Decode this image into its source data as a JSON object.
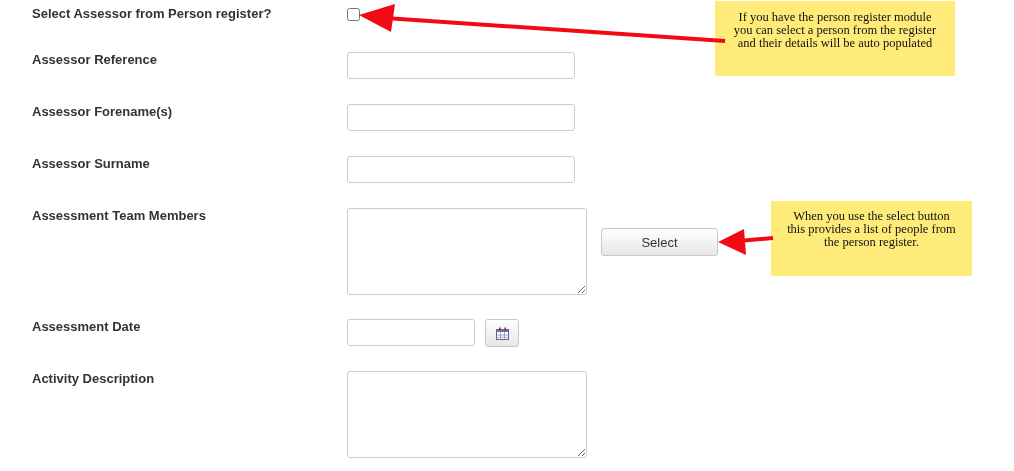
{
  "fields": [
    {
      "kind": "checkbox",
      "label": "Select Assessor from Person register?",
      "checked": false
    },
    {
      "kind": "text",
      "label": "Assessor Reference"
    },
    {
      "kind": "text",
      "label": "Assessor Forename(s)"
    },
    {
      "kind": "text",
      "label": "Assessor Surname"
    },
    {
      "kind": "textarea",
      "label": "Assessment Team Members",
      "button": "Select"
    },
    {
      "kind": "date",
      "label": "Assessment Date"
    },
    {
      "kind": "textarea",
      "label": "Activity Description"
    }
  ],
  "callouts": [
    {
      "text": "If you have the person register module you can select a person from the register and their details will be auto populated"
    },
    {
      "text": "When you use the select button this provides a list of people from the person register."
    }
  ]
}
